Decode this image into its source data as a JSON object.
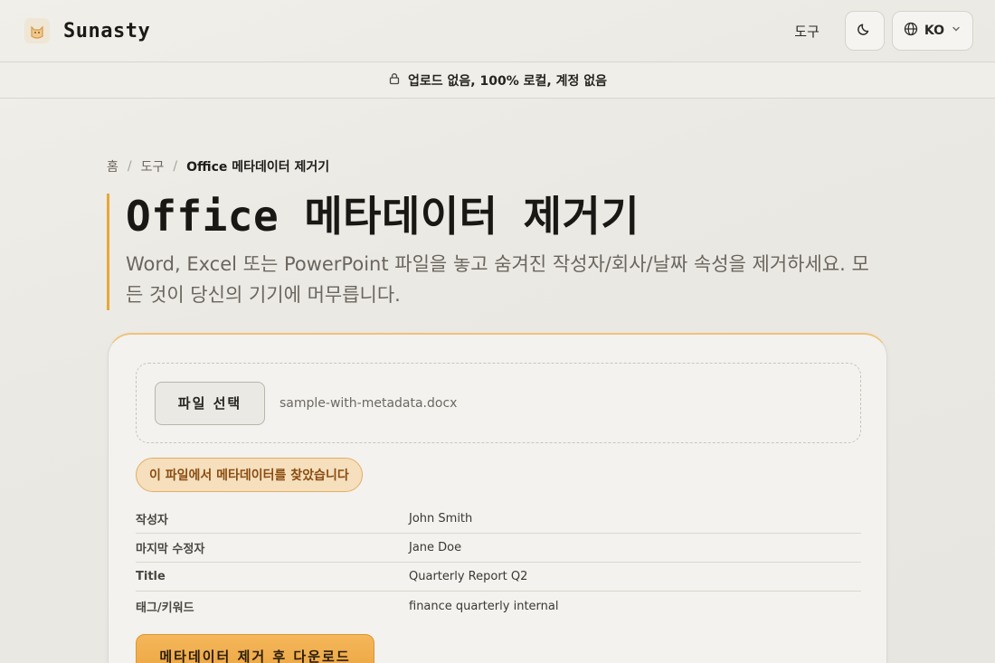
{
  "header": {
    "brand": "Sunasty",
    "nav_tools": "도구",
    "lang_code": "KO",
    "icons": [
      "cat-logo-icon",
      "moon-icon",
      "globe-icon",
      "chevron-down-icon"
    ]
  },
  "banner": {
    "text": "업로드 없음, 100% 로컬, 계정 없음",
    "icon": "lock-icon"
  },
  "breadcrumb": {
    "home": "홈",
    "tools": "도구",
    "current": "Office 메타데이터 제거기"
  },
  "hero": {
    "title": "Office 메타데이터 제거기",
    "subtitle": "Word, Excel 또는 PowerPoint 파일을 놓고 숨겨진 작성자/회사/날짜 속성을 제거하세요. 모든 것이 당신의 기기에 머무릅니다."
  },
  "uploader": {
    "button_label": "파일 선택",
    "file_name": "sample-with-metadata.docx"
  },
  "result": {
    "badge": "이 파일에서 메타데이터를 찾았습니다",
    "rows": [
      {
        "key": "작성자",
        "value": "John Smith"
      },
      {
        "key": "마지막 수정자",
        "value": "Jane Doe"
      },
      {
        "key": "Title",
        "value": "Quarterly Report Q2"
      },
      {
        "key": "태그/키워드",
        "value": "finance quarterly internal"
      }
    ],
    "download_label": "메타데이터 제거 후 다운로드"
  },
  "colors": {
    "accent": "#eca441",
    "badge_bg": "#f5dfbd",
    "badge_text": "#8a4d12"
  }
}
